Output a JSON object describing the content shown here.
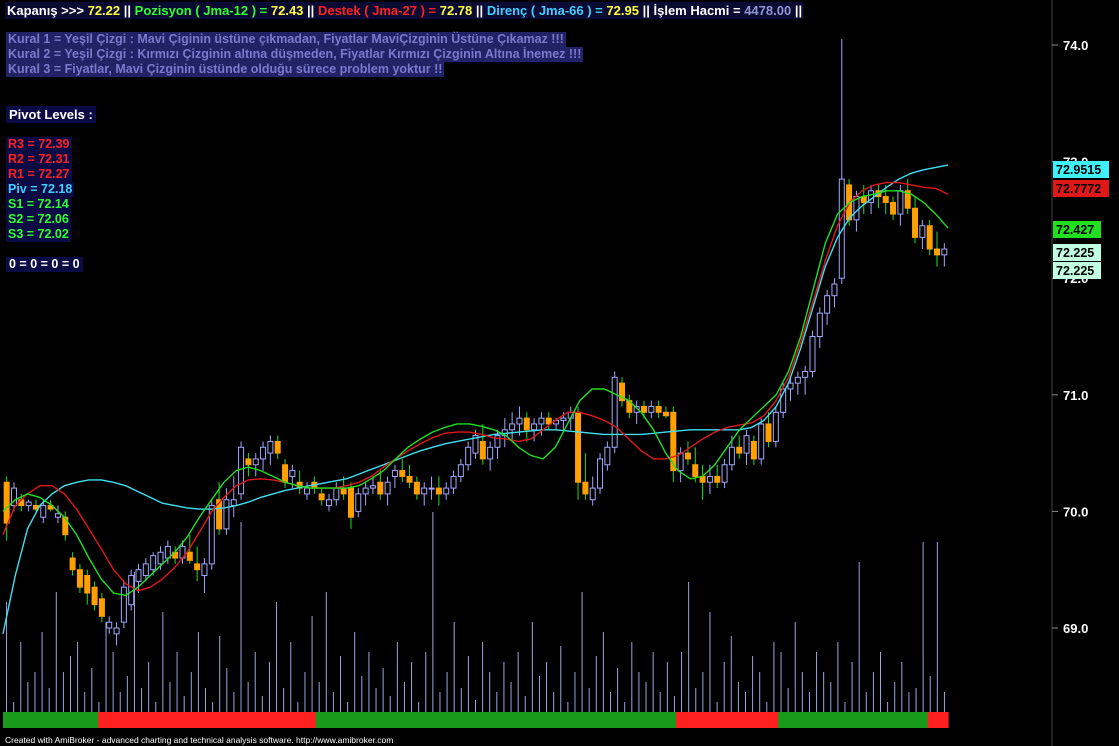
{
  "header": {
    "close_label": "Kapanış >>>",
    "close_value": "72.22",
    "position_label": "Pozisyon ( Jma-12 ) =",
    "position_value": "72.43",
    "support_label": "Destek ( Jma-27 ) =",
    "support_value": "72.78",
    "resistance_label": "Direnç ( Jma-66 ) =",
    "resistance_value": "72.95",
    "volume_label": "İşlem Hacmi =",
    "volume_value": "4478.00",
    "sep": "||"
  },
  "rules": [
    "Kural 1 = Yeşil Çizgi : Mavi Çiginin üstüne çıkmadan, Fiyatlar MaviÇizginin Üstüne Çıkamaz !!!",
    "Kural 2 = Yeşil Çizgi : Kırmızı Çizginin altına düşmeden, Fiyatlar Kırmızı Çizginin Altına İnemez !!!",
    "Kural 3 = Fiyatlar, Mavi Çizginin üstünde olduğu sürece problem yoktur !!"
  ],
  "pivot": {
    "title": "Pivot Levels :",
    "levels": [
      {
        "label": "R3 = 72.39",
        "color": "#ff2020"
      },
      {
        "label": "R2 = 72.31",
        "color": "#ff2020"
      },
      {
        "label": "R1 = 72.27",
        "color": "#ff2020"
      },
      {
        "label": "Piv = 72.18",
        "color": "#40d0ff"
      },
      {
        "label": "S1 = 72.14",
        "color": "#30ff30"
      },
      {
        "label": "S2 = 72.06",
        "color": "#30ff30"
      },
      {
        "label": "S3 = 72.02",
        "color": "#30ff30"
      }
    ],
    "zeros": "0 = 0 = 0 = 0"
  },
  "footer": "Created with AmiBroker - advanced charting and technical analysis software. http://www.amibroker.com",
  "colors": {
    "background": "#000000",
    "up_candle": "#9fa8ff",
    "down_candle": "#ffa000",
    "jma12": "#20e020",
    "jma27": "#e01818",
    "jma66": "#40e0f0",
    "volume": "#9aa4e0",
    "band_green": "#1a9a1a",
    "band_red": "#ff2020",
    "axis_text": "#ffffff"
  },
  "chart_data": {
    "type": "candlestick",
    "ylim": [
      68.0,
      74.35
    ],
    "y_ticks": [
      "74.0",
      "73.0",
      "72.0",
      "71.0",
      "70.0",
      "69.0"
    ],
    "y_tick_values": [
      74.0,
      73.0,
      72.0,
      71.0,
      70.0,
      69.0
    ],
    "price_tags": [
      {
        "label": "72.9515",
        "value": 72.9515,
        "bg": "#40f0ff",
        "fg": "#000000"
      },
      {
        "label": "72.7772",
        "value": 72.7772,
        "bg": "#e01818",
        "fg": "#000000"
      },
      {
        "label": "72.427",
        "value": 72.427,
        "bg": "#20e020",
        "fg": "#000000"
      },
      {
        "label": "72.225",
        "value": 72.225,
        "bg": "#c0ffe0",
        "fg": "#000000"
      },
      {
        "label": "72.225",
        "value": 72.225,
        "bg": "#c0ffe0",
        "fg": "#000000"
      }
    ],
    "candles": [
      [
        70.25,
        70.3,
        69.75,
        69.9
      ],
      [
        70.05,
        70.25,
        70.0,
        70.2
      ],
      [
        70.1,
        70.15,
        70.0,
        70.05
      ],
      [
        70.05,
        70.1,
        70.0,
        70.08
      ],
      [
        70.05,
        70.1,
        70.0,
        70.02
      ],
      [
        69.95,
        70.1,
        69.9,
        70.05
      ],
      [
        70.05,
        70.1,
        70.0,
        70.02
      ],
      [
        69.95,
        70.05,
        69.9,
        69.98
      ],
      [
        69.95,
        70.0,
        69.75,
        69.8
      ],
      [
        69.6,
        69.65,
        69.45,
        69.5
      ],
      [
        69.5,
        69.55,
        69.3,
        69.35
      ],
      [
        69.45,
        69.5,
        69.2,
        69.3
      ],
      [
        69.35,
        69.4,
        69.15,
        69.2
      ],
      [
        69.25,
        69.3,
        69.05,
        69.1
      ],
      [
        69.0,
        69.1,
        68.95,
        69.05
      ],
      [
        68.95,
        69.05,
        68.85,
        69.0
      ],
      [
        69.05,
        69.4,
        69.0,
        69.35
      ],
      [
        69.2,
        69.5,
        69.15,
        69.45
      ],
      [
        69.4,
        69.55,
        69.3,
        69.5
      ],
      [
        69.45,
        69.6,
        69.4,
        69.55
      ],
      [
        69.5,
        69.65,
        69.45,
        69.62
      ],
      [
        69.55,
        69.7,
        69.5,
        69.65
      ],
      [
        69.6,
        69.75,
        69.55,
        69.7
      ],
      [
        69.65,
        69.7,
        69.55,
        69.6
      ],
      [
        69.6,
        69.75,
        69.55,
        69.7
      ],
      [
        69.65,
        69.8,
        69.55,
        69.58
      ],
      [
        69.55,
        69.7,
        69.4,
        69.5
      ],
      [
        69.45,
        69.6,
        69.3,
        69.55
      ],
      [
        69.55,
        70.1,
        69.5,
        70.05
      ],
      [
        70.1,
        70.25,
        69.8,
        69.85
      ],
      [
        69.85,
        70.2,
        69.8,
        70.1
      ],
      [
        70.05,
        70.3,
        69.95,
        70.1
      ],
      [
        70.15,
        70.6,
        70.1,
        70.55
      ],
      [
        70.45,
        70.5,
        70.3,
        70.4
      ],
      [
        70.4,
        70.5,
        70.3,
        70.45
      ],
      [
        70.45,
        70.6,
        70.35,
        70.55
      ],
      [
        70.5,
        70.65,
        70.4,
        70.6
      ],
      [
        70.6,
        70.65,
        70.45,
        70.5
      ],
      [
        70.4,
        70.45,
        70.2,
        70.25
      ],
      [
        70.3,
        70.4,
        70.2,
        70.35
      ],
      [
        70.25,
        70.35,
        70.15,
        70.2
      ],
      [
        70.15,
        70.25,
        70.1,
        70.2
      ],
      [
        70.25,
        70.3,
        70.15,
        70.2
      ],
      [
        70.15,
        70.2,
        70.05,
        70.1
      ],
      [
        70.05,
        70.15,
        70.0,
        70.1
      ],
      [
        70.1,
        70.25,
        70.05,
        70.2
      ],
      [
        70.2,
        70.3,
        70.1,
        70.15
      ],
      [
        70.2,
        70.25,
        69.85,
        69.95
      ],
      [
        70.0,
        70.2,
        69.95,
        70.15
      ],
      [
        70.15,
        70.25,
        70.05,
        70.2
      ],
      [
        70.2,
        70.3,
        70.15,
        70.22
      ],
      [
        70.25,
        70.35,
        70.1,
        70.15
      ],
      [
        70.15,
        70.3,
        70.05,
        70.25
      ],
      [
        70.3,
        70.4,
        70.2,
        70.35
      ],
      [
        70.35,
        70.45,
        70.25,
        70.3
      ],
      [
        70.3,
        70.4,
        70.2,
        70.25
      ],
      [
        70.25,
        70.3,
        70.1,
        70.15
      ],
      [
        70.15,
        70.25,
        70.05,
        70.2
      ],
      [
        70.2,
        70.3,
        70.1,
        70.2
      ],
      [
        70.2,
        70.3,
        70.05,
        70.15
      ],
      [
        70.15,
        70.25,
        70.1,
        70.2
      ],
      [
        70.2,
        70.35,
        70.15,
        70.3
      ],
      [
        70.3,
        70.45,
        70.25,
        70.4
      ],
      [
        70.4,
        70.6,
        70.35,
        70.55
      ],
      [
        70.5,
        70.7,
        70.45,
        70.65
      ],
      [
        70.6,
        70.75,
        70.4,
        70.45
      ],
      [
        70.45,
        70.6,
        70.35,
        70.55
      ],
      [
        70.55,
        70.7,
        70.45,
        70.65
      ],
      [
        70.65,
        70.8,
        70.55,
        70.7
      ],
      [
        70.7,
        70.85,
        70.6,
        70.75
      ],
      [
        70.75,
        70.9,
        70.65,
        70.8
      ],
      [
        70.8,
        70.85,
        70.6,
        70.7
      ],
      [
        70.7,
        70.8,
        70.6,
        70.75
      ],
      [
        70.75,
        70.85,
        70.65,
        70.8
      ],
      [
        70.8,
        70.85,
        70.7,
        70.75
      ],
      [
        70.75,
        70.8,
        70.7,
        70.78
      ],
      [
        70.78,
        70.85,
        70.7,
        70.8
      ],
      [
        70.8,
        70.9,
        70.7,
        70.85
      ],
      [
        70.85,
        70.9,
        70.1,
        70.25
      ],
      [
        70.25,
        70.5,
        70.1,
        70.15
      ],
      [
        70.1,
        70.3,
        70.05,
        70.2
      ],
      [
        70.2,
        70.5,
        70.15,
        70.45
      ],
      [
        70.4,
        70.6,
        70.35,
        70.55
      ],
      [
        70.55,
        71.2,
        70.5,
        71.15
      ],
      [
        71.1,
        71.15,
        70.9,
        70.95
      ],
      [
        70.95,
        71.0,
        70.8,
        70.85
      ],
      [
        70.85,
        70.95,
        70.75,
        70.9
      ],
      [
        70.9,
        70.95,
        70.8,
        70.85
      ],
      [
        70.85,
        70.95,
        70.8,
        70.9
      ],
      [
        70.9,
        70.95,
        70.8,
        70.85
      ],
      [
        70.85,
        70.9,
        70.8,
        70.82
      ],
      [
        70.85,
        70.9,
        70.25,
        70.35
      ],
      [
        70.35,
        70.55,
        70.25,
        70.5
      ],
      [
        70.5,
        70.6,
        70.4,
        70.45
      ],
      [
        70.4,
        70.55,
        70.25,
        70.3
      ],
      [
        70.3,
        70.4,
        70.1,
        70.25
      ],
      [
        70.25,
        70.4,
        70.15,
        70.3
      ],
      [
        70.3,
        70.4,
        70.2,
        70.25
      ],
      [
        70.25,
        70.45,
        70.2,
        70.4
      ],
      [
        70.4,
        70.65,
        70.35,
        70.55
      ],
      [
        70.55,
        70.65,
        70.45,
        70.5
      ],
      [
        70.5,
        70.7,
        70.4,
        70.65
      ],
      [
        70.6,
        70.65,
        70.4,
        70.45
      ],
      [
        70.45,
        70.8,
        70.4,
        70.75
      ],
      [
        70.75,
        70.85,
        70.55,
        70.6
      ],
      [
        70.6,
        70.9,
        70.55,
        70.85
      ],
      [
        70.85,
        71.1,
        70.8,
        71.05
      ],
      [
        71.05,
        71.15,
        70.95,
        71.1
      ],
      [
        71.1,
        71.2,
        71.0,
        71.15
      ],
      [
        71.15,
        71.25,
        71.0,
        71.2
      ],
      [
        71.2,
        71.55,
        71.15,
        71.5
      ],
      [
        71.5,
        71.75,
        71.4,
        71.7
      ],
      [
        71.7,
        71.9,
        71.6,
        71.85
      ],
      [
        71.85,
        72.0,
        71.75,
        71.95
      ],
      [
        72.0,
        74.05,
        71.95,
        72.85
      ],
      [
        72.8,
        72.85,
        72.45,
        72.5
      ],
      [
        72.5,
        72.75,
        72.4,
        72.7
      ],
      [
        72.7,
        72.8,
        72.55,
        72.65
      ],
      [
        72.65,
        72.8,
        72.55,
        72.75
      ],
      [
        72.75,
        72.8,
        72.6,
        72.7
      ],
      [
        72.7,
        72.8,
        72.55,
        72.65
      ],
      [
        72.65,
        72.7,
        72.5,
        72.55
      ],
      [
        72.55,
        72.8,
        72.45,
        72.75
      ],
      [
        72.75,
        72.85,
        72.55,
        72.6
      ],
      [
        72.6,
        72.7,
        72.3,
        72.35
      ],
      [
        72.35,
        72.5,
        72.25,
        72.45
      ],
      [
        72.45,
        72.5,
        72.2,
        72.25
      ],
      [
        72.25,
        72.4,
        72.1,
        72.2
      ],
      [
        72.2,
        72.3,
        72.1,
        72.25
      ]
    ],
    "jma12": [
      70.0,
      70.1,
      70.15,
      70.12,
      70.05,
      69.95,
      69.8,
      69.6,
      69.42,
      69.3,
      69.28,
      69.35,
      69.45,
      69.55,
      69.65,
      69.78,
      69.95,
      70.1,
      70.25,
      70.35,
      70.38,
      70.35,
      70.3,
      70.25,
      70.22,
      70.2,
      70.2,
      70.2,
      70.2,
      70.22,
      70.28,
      70.35,
      70.45,
      70.55,
      70.62,
      70.68,
      70.72,
      70.75,
      70.75,
      70.73,
      70.7,
      70.65,
      70.55,
      70.48,
      70.45,
      70.55,
      70.75,
      70.95,
      71.05,
      71.05,
      71.0,
      70.95,
      70.85,
      70.7,
      70.5,
      70.35,
      70.28,
      70.3,
      70.4,
      70.55,
      70.7,
      70.8,
      70.9,
      71.0,
      71.2,
      71.5,
      71.9,
      72.3,
      72.55,
      72.65,
      72.7,
      72.72,
      72.75,
      72.75,
      72.72,
      72.65,
      72.55,
      72.43
    ],
    "jma27": [
      69.8,
      70.05,
      70.15,
      70.22,
      70.22,
      70.15,
      70.02,
      69.85,
      69.68,
      69.5,
      69.38,
      69.32,
      69.35,
      69.42,
      69.52,
      69.65,
      69.82,
      70.0,
      70.12,
      70.22,
      70.27,
      70.28,
      70.27,
      70.25,
      70.22,
      70.2,
      70.2,
      70.2,
      70.22,
      70.25,
      70.3,
      70.38,
      70.45,
      70.52,
      70.58,
      70.63,
      70.67,
      70.68,
      70.68,
      70.66,
      70.63,
      70.62,
      70.6,
      70.62,
      70.7,
      70.78,
      70.85,
      70.85,
      70.82,
      70.78,
      70.72,
      70.62,
      70.52,
      70.45,
      70.45,
      70.48,
      70.55,
      70.62,
      70.68,
      70.72,
      70.74,
      70.76,
      70.82,
      70.95,
      71.15,
      71.45,
      71.8,
      72.15,
      72.45,
      72.65,
      72.75,
      72.8,
      72.82,
      72.82,
      72.8,
      72.78,
      72.77,
      72.72
    ],
    "jma66": [
      68.95,
      69.45,
      69.85,
      70.05,
      70.15,
      70.22,
      70.25,
      70.27,
      70.27,
      70.25,
      70.22,
      70.17,
      70.12,
      70.07,
      70.05,
      70.03,
      70.02,
      70.02,
      70.03,
      70.05,
      70.08,
      70.12,
      70.15,
      70.18,
      70.2,
      70.22,
      70.24,
      70.26,
      70.28,
      70.32,
      70.36,
      70.4,
      70.44,
      70.48,
      70.52,
      70.55,
      70.58,
      70.6,
      70.62,
      70.64,
      70.66,
      70.67,
      70.68,
      70.69,
      70.7,
      70.7,
      70.69,
      70.68,
      70.67,
      70.66,
      70.66,
      70.66,
      70.66,
      70.67,
      70.68,
      70.69,
      70.7,
      70.7,
      70.7,
      70.7,
      70.7,
      70.72,
      70.78,
      70.9,
      71.1,
      71.4,
      71.75,
      72.1,
      72.35,
      72.52,
      72.62,
      72.7,
      72.78,
      72.85,
      72.9,
      72.93,
      72.95,
      72.97
    ],
    "volume": [
      0.55,
      0.05,
      0.35,
      0.15,
      0.2,
      0.4,
      0.12,
      0.6,
      0.2,
      0.28,
      0.35,
      0.1,
      0.22,
      0.05,
      0.45,
      0.3,
      0.1,
      0.18,
      0.7,
      0.12,
      0.25,
      0.05,
      0.5,
      0.15,
      0.3,
      0.08,
      0.2,
      0.4,
      0.12,
      0.05,
      0.38,
      0.22,
      0.1,
      0.95,
      0.15,
      0.3,
      0.08,
      0.25,
      0.55,
      0.12,
      0.35,
      0.05,
      0.2,
      0.48,
      0.15,
      0.6,
      0.1,
      0.28,
      0.05,
      0.4,
      0.18,
      0.3,
      0.12,
      0.22,
      0.08,
      0.35,
      0.15,
      0.25,
      0.05,
      0.3,
      1.0,
      0.1,
      0.2,
      0.45,
      0.12,
      0.28,
      0.06,
      0.35,
      0.2,
      0.1,
      0.25,
      0.15,
      0.3,
      0.08,
      0.45,
      0.18,
      0.25,
      0.1,
      0.33,
      0.05,
      0.2,
      0.6,
      0.12,
      0.28,
      0.4,
      0.1,
      0.22,
      0.05,
      0.35,
      0.2,
      0.15,
      0.3,
      0.1,
      0.25,
      0.08,
      0.3,
      0.65,
      0.12,
      0.2,
      0.5,
      0.05,
      0.25,
      0.38,
      0.15,
      0.1,
      0.28,
      0.2,
      0.05,
      0.35,
      0.3,
      0.12,
      0.45,
      0.2,
      0.1,
      0.3,
      0.2,
      0.15,
      0.35,
      0.05,
      0.25,
      0.75,
      0.1,
      0.2,
      0.3,
      0.05,
      0.15,
      0.25,
      0.1,
      0.12,
      0.85,
      0.18,
      0.85,
      0.1
    ],
    "band": [
      "g",
      "g",
      "g",
      "g",
      "g",
      "g",
      "g",
      "g",
      "g",
      "g",
      "g",
      "g",
      "g",
      "g",
      "r",
      "r",
      "r",
      "r",
      "r",
      "r",
      "r",
      "r",
      "r",
      "r",
      "r",
      "r",
      "r",
      "r",
      "r",
      "r",
      "r",
      "r",
      "r",
      "r",
      "r",
      "r",
      "r",
      "r",
      "r",
      "r",
      "r",
      "r",
      "r",
      "r",
      "r",
      "r",
      "g",
      "g",
      "g",
      "g",
      "g",
      "g",
      "g",
      "g",
      "g",
      "g",
      "g",
      "g",
      "g",
      "g",
      "g",
      "g",
      "g",
      "g",
      "g",
      "g",
      "g",
      "g",
      "g",
      "g",
      "g",
      "g",
      "g",
      "g",
      "g",
      "g",
      "g",
      "g",
      "g",
      "g",
      "g",
      "g",
      "g",
      "g",
      "g",
      "g",
      "g",
      "g",
      "g",
      "g",
      "g",
      "g",
      "g",
      "g",
      "g",
      "g",
      "g",
      "g",
      "g",
      "r",
      "r",
      "r",
      "r",
      "r",
      "r",
      "r",
      "r",
      "r",
      "r",
      "r",
      "r",
      "r",
      "r",
      "r",
      "g",
      "g",
      "g",
      "g",
      "g",
      "g",
      "g",
      "g",
      "g",
      "g",
      "g",
      "g",
      "g",
      "g",
      "g",
      "g",
      "g",
      "g",
      "g",
      "g",
      "g",
      "g",
      "r",
      "r",
      "r"
    ]
  }
}
